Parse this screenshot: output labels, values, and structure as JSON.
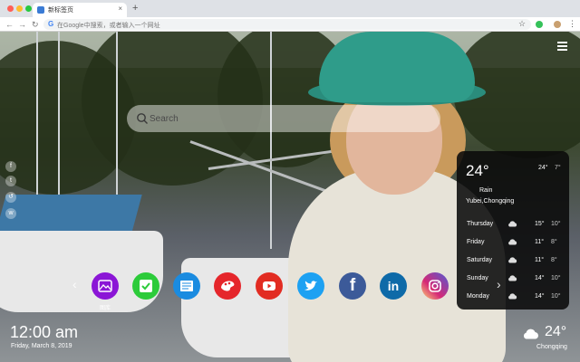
{
  "browser": {
    "tab_title": "新标签页",
    "tab_close": "×",
    "new_tab": "+",
    "omnibox_placeholder": "在Google中搜索，或者输入一个网址",
    "star": "☆",
    "menu": "⋮"
  },
  "search": {
    "placeholder": "Search"
  },
  "social_icons": [
    "facebook-icon",
    "twitter-icon",
    "share-icon",
    "weibo-icon"
  ],
  "weather_card": {
    "temp": "24°",
    "high": "24°",
    "low": "7°",
    "condition": "Rain",
    "location": "Yubei,Chongqing",
    "forecast": [
      {
        "day": "Thursday",
        "high": "15°",
        "low": "10°",
        "icon": "cloud-icon"
      },
      {
        "day": "Friday",
        "high": "11°",
        "low": "8°",
        "icon": "cloud-icon"
      },
      {
        "day": "Saturday",
        "high": "11°",
        "low": "8°",
        "icon": "cloud-icon"
      },
      {
        "day": "Sunday",
        "high": "14°",
        "low": "10°",
        "icon": "cloud-icon"
      },
      {
        "day": "Monday",
        "high": "14°",
        "low": "10°",
        "icon": "cloud-icon"
      }
    ]
  },
  "dock": {
    "prev": "‹",
    "next": "›",
    "apps": [
      {
        "name": "gallery",
        "label": "图库",
        "color": "#8b16d6"
      },
      {
        "name": "tasks",
        "label": "",
        "color": "#2ccb3a"
      },
      {
        "name": "news",
        "label": "",
        "color": "#1a8be0"
      },
      {
        "name": "palette",
        "label": "",
        "color": "#e5262b"
      },
      {
        "name": "youtube",
        "label": "",
        "color": "#e22c22"
      },
      {
        "name": "twitter",
        "label": "",
        "color": "#1da1f2"
      },
      {
        "name": "facebook",
        "label": "f",
        "color": "#3c5a99"
      },
      {
        "name": "linkedin",
        "label": "in",
        "color": "#0e6aa8"
      },
      {
        "name": "instagram",
        "label": "",
        "color": "#d62976"
      }
    ]
  },
  "clock": {
    "time": "12:00 am",
    "date": "Friday, March 8, 2019"
  },
  "current_weather": {
    "temp": "24°",
    "city": "Chongqing"
  }
}
